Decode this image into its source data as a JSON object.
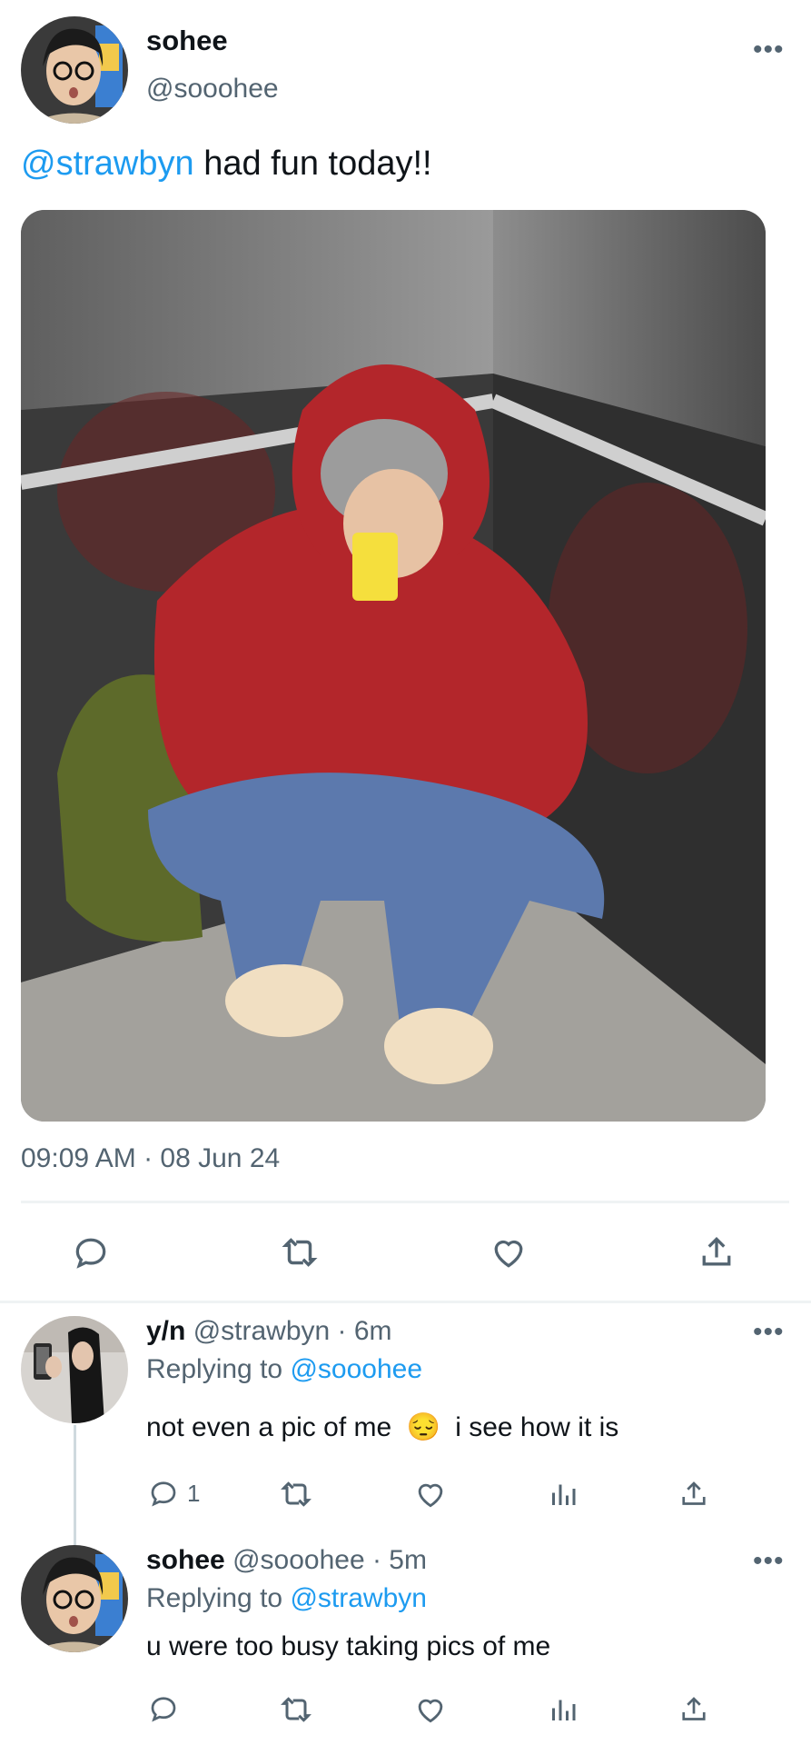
{
  "main_tweet": {
    "author_name": "sohee",
    "author_handle": "@sooohee",
    "mention": "@strawbyn",
    "text": " had fun today!!",
    "timestamp": "09:09 AM · 08 Jun 24",
    "actions": [
      "reply",
      "retweet",
      "like",
      "share"
    ]
  },
  "replies": [
    {
      "author_name": "y/n",
      "author_handle": "@strawbyn",
      "time": "· 6m",
      "replying_label": "Replying to",
      "replying_to": "@sooohee",
      "text_before": "not even a pic of me",
      "emoji": "😔",
      "text_after": "i see how it is",
      "reply_count": "1"
    },
    {
      "author_name": "sohee",
      "author_handle": "@sooohee",
      "time": "· 5m",
      "replying_label": "Replying to",
      "replying_to": "@strawbyn",
      "text": "u were too busy taking pics of me"
    }
  ],
  "more_icon": "•••",
  "colors": {
    "link": "#1d9bf0",
    "muted": "#536471",
    "divider": "#eff3f4"
  }
}
